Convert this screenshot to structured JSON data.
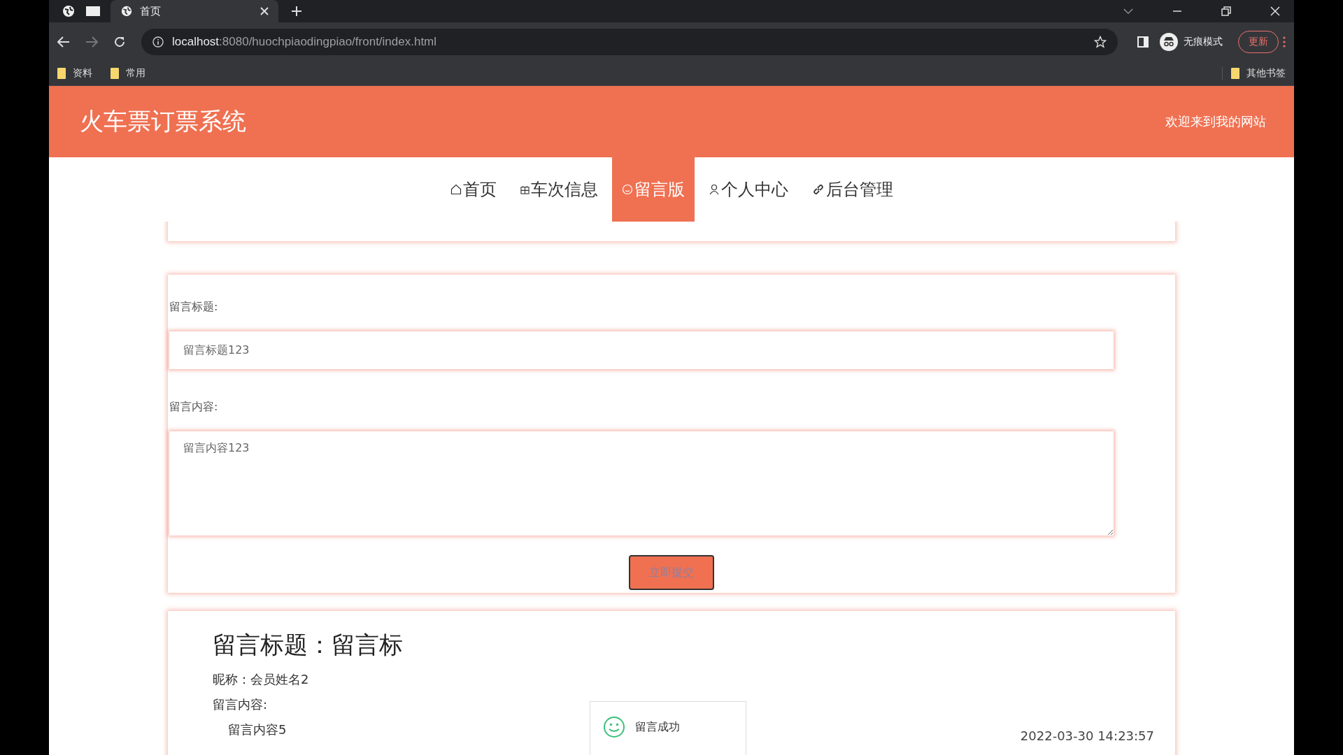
{
  "browser": {
    "tabs": [
      {
        "title": "首页",
        "selected": true
      }
    ],
    "url_host": "localhost",
    "url_rest": ":8080/huochpiaodingpiao/front/index.html",
    "profile_label": "无痕模式",
    "update_button": "更新",
    "bookmarks": [
      "资料",
      "常用"
    ],
    "other_bookmarks": "其他书签"
  },
  "header": {
    "title": "火车票订票系统",
    "welcome": "欢迎来到我的网站"
  },
  "nav": [
    {
      "label": "首页",
      "kind": "home",
      "selected": false
    },
    {
      "label": "车次信息",
      "kind": "grid",
      "selected": false
    },
    {
      "label": "留言版",
      "kind": "smile",
      "selected": true
    },
    {
      "label": "个人中心",
      "kind": "user",
      "selected": false
    },
    {
      "label": "后台管理",
      "kind": "link",
      "selected": false
    }
  ],
  "form": {
    "title_label": "留言标题:",
    "title_value": "留言标题123",
    "content_label": "留言内容:",
    "content_value": "留言内容123",
    "submit": "立即提交"
  },
  "messages": [
    {
      "title": "留言标题：留言标",
      "nickname": "昵称：会员姓名2",
      "content_label": "留言内容:",
      "content": "留言内容5",
      "time": "2022-03-30 14:23:57"
    }
  ],
  "toast": {
    "text": "留言成功"
  }
}
